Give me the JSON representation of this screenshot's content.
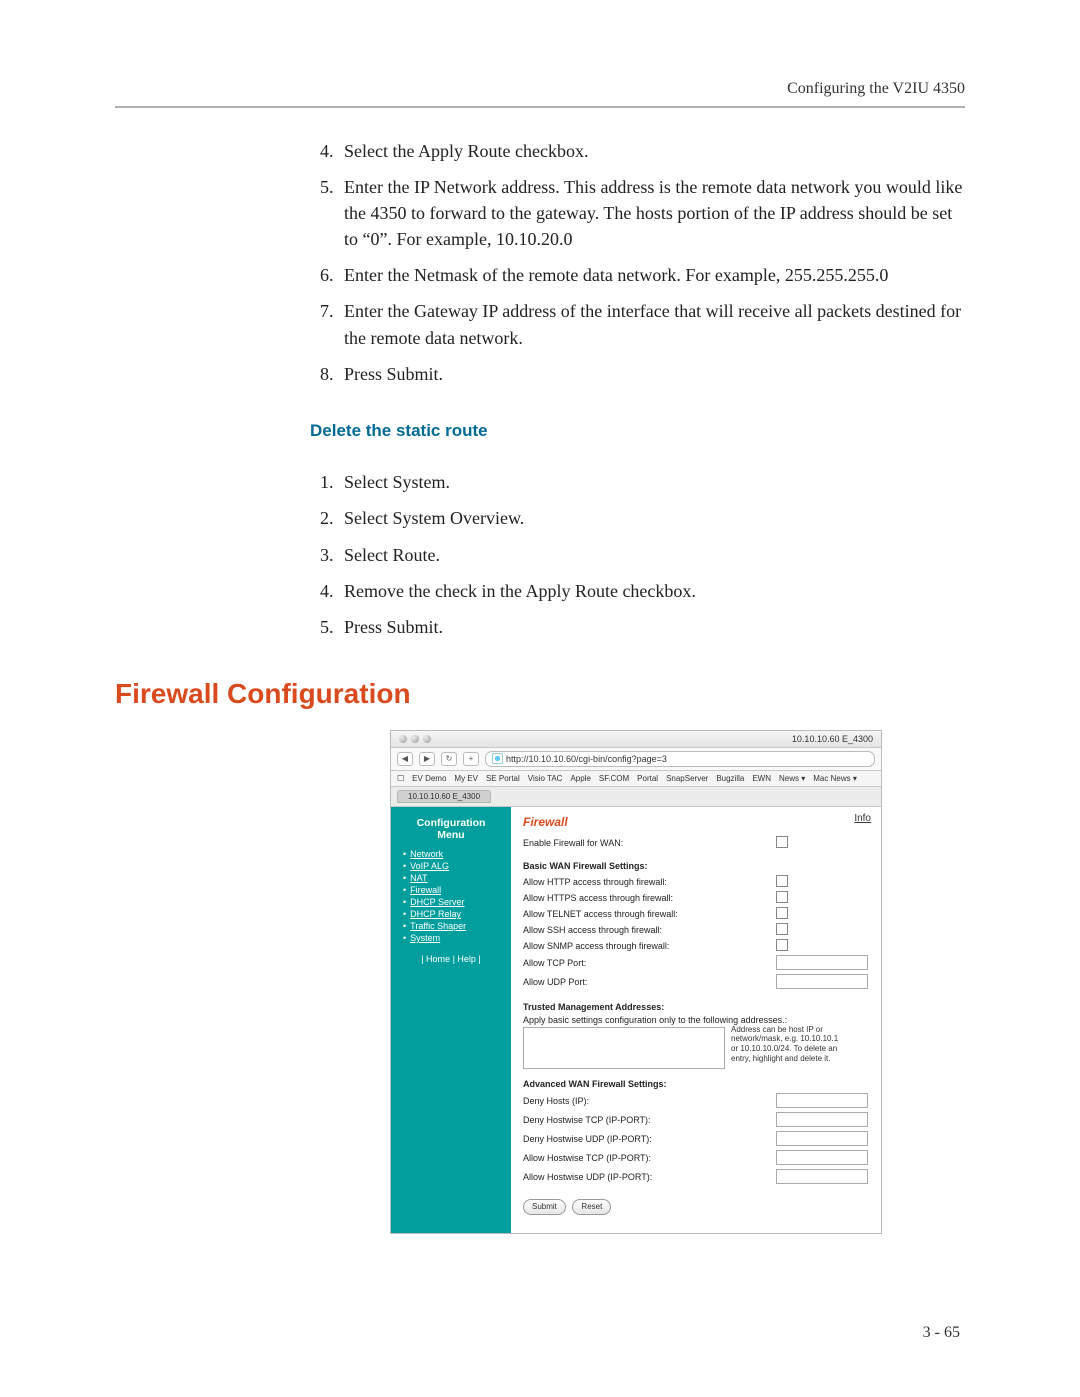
{
  "header": {
    "title": "Configuring the V2IU 4350"
  },
  "steps1": {
    "start": 4,
    "items": [
      "Select the Apply Route checkbox.",
      "Enter the IP Network address. This address is the remote data network you would like the 4350 to forward to the gateway. The hosts portion of the IP address should be set to “0”. For example, 10.10.20.0",
      "Enter the Netmask of the remote data network. For example, 255.255.255.0",
      "Enter the Gateway IP address of the interface that will receive all packets destined for the remote data network.",
      "Press Submit."
    ]
  },
  "sub_heading": "Delete the static route",
  "steps2": {
    "items": [
      "Select System.",
      "Select System Overview.",
      "Select Route.",
      "Remove the check in the Apply Route checkbox.",
      "Press Submit."
    ]
  },
  "section_heading": "Firewall Configuration",
  "footer_page": "3 - 65",
  "screenshot": {
    "title_right": "10.10.10.60 E_4300",
    "nav": {
      "back": "◀",
      "fwd": "▶",
      "reload": "↻",
      "plus": "+"
    },
    "url": "http://10.10.10.60/cgi-bin/config?page=3",
    "bookmarks": [
      "☐",
      "EV Demo",
      "My EV",
      "SE Portal",
      "Visio TAC",
      "Apple",
      "SF.COM",
      "Portal",
      "SnapServer",
      "Bugzilla",
      "EWN",
      "News ▾",
      "Mac News ▾"
    ],
    "tab": "10.10.10.60 E_4300",
    "sidebar": {
      "title1": "Configuration",
      "title2": "Menu",
      "items": [
        "Network",
        "VoIP ALG",
        "NAT",
        "Firewall",
        "DHCP Server",
        "DHCP Relay",
        "Traffic Shaper",
        "System"
      ],
      "footer": "| Home | Help |"
    },
    "content": {
      "info": "Info",
      "heading": "Firewall",
      "enable_label": "Enable Firewall for WAN:",
      "basic_heading": "Basic WAN Firewall Settings:",
      "basic": [
        "Allow HTTP access through firewall:",
        "Allow HTTPS access through firewall:",
        "Allow TELNET access through firewall:",
        "Allow SSH access through firewall:",
        "Allow SNMP access through firewall:"
      ],
      "tcp_port": "Allow TCP Port:",
      "udp_port": "Allow UDP Port:",
      "trusted_heading": "Trusted Management Addresses:",
      "trusted_text": "Apply basic settings configuration only to the following addresses.:",
      "trusted_hint": "Address can be host IP or network/mask, e.g. 10.10.10.1 or 10.10.10.0/24. To delete an entry, highlight and delete it.",
      "adv_heading": "Advanced WAN Firewall Settings:",
      "adv": [
        "Deny Hosts (IP):",
        "Deny Hostwise TCP (IP-PORT):",
        "Deny Hostwise UDP (IP-PORT):",
        "Allow Hostwise TCP (IP-PORT):",
        "Allow Hostwise UDP (IP-PORT):"
      ],
      "submit": "Submit",
      "reset": "Reset"
    }
  }
}
